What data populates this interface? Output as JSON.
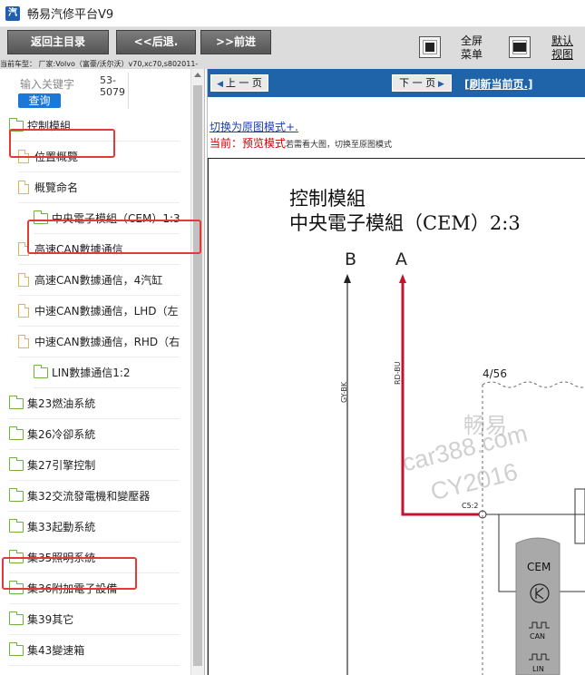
{
  "window": {
    "app_icon": "app-logo-icon",
    "title": "畅易汽修平台V9"
  },
  "toolbar": {
    "home_label": "返回主目录",
    "back_label": "<<后退.",
    "forward_label": ">>前进",
    "fullscreen_label": "全屏\n菜单",
    "fit_label": "默认\n视图",
    "fullscreen_icon": "fullscreen-icon",
    "fit_icon": "fit-view-icon"
  },
  "vehicle_info": "当前车型： 厂家:Volvo（富豪/沃尔沃）v70,xc70,s802011-",
  "search": {
    "label": "输入关键字",
    "value": "53-\n5079",
    "button_label": "查询"
  },
  "tree": {
    "items": [
      {
        "label": "控制模組",
        "type": "folder",
        "level": 0
      },
      {
        "label": "位置概覽",
        "type": "doc",
        "level": 1
      },
      {
        "label": "概覽命名",
        "type": "doc",
        "level": 1
      },
      {
        "label": "中央電子模組（CEM）1:3",
        "type": "folder",
        "level": 2
      },
      {
        "label": "高速CAN數據通信",
        "type": "doc",
        "level": 1
      },
      {
        "label": "高速CAN數據通信，4汽缸",
        "type": "doc",
        "level": 1
      },
      {
        "label": "中速CAN數據通信，LHD（左",
        "type": "doc",
        "level": 1
      },
      {
        "label": "中速CAN數據通信，RHD（右",
        "type": "doc",
        "level": 1
      },
      {
        "label": "LIN數據通信1:2",
        "type": "folder",
        "level": 2
      },
      {
        "label": "集23燃油系統",
        "type": "folder",
        "level": 0
      },
      {
        "label": "集26冷卻系統",
        "type": "folder",
        "level": 0
      },
      {
        "label": "集27引擎控制",
        "type": "folder",
        "level": 0
      },
      {
        "label": "集32交流發電機和變壓器",
        "type": "folder",
        "level": 0
      },
      {
        "label": "集33起動系統",
        "type": "folder",
        "level": 0
      },
      {
        "label": "集35照明系統",
        "type": "folder",
        "level": 0
      },
      {
        "label": "集36附加電子設備",
        "type": "folder",
        "level": 0
      },
      {
        "label": "集39其它",
        "type": "folder",
        "level": 0
      },
      {
        "label": "集43變速箱",
        "type": "folder",
        "level": 0
      }
    ]
  },
  "nav": {
    "prev_label": "上 一 页",
    "next_label": "下 一 页",
    "refresh_label": "[刷新当前页.]"
  },
  "view_mode": {
    "switch_link": "切换为原图模式+.",
    "status_prefix": "当前：",
    "status_mode": "预览模式",
    "status_hint": "若需看大图，切换至原图模式"
  },
  "diagram": {
    "title_line1": "控制模組",
    "title_line2": "中央電子模組（CEM）2:3",
    "labels": {
      "wire_b": "B",
      "wire_a": "A",
      "wire_b_color": "GY-BK",
      "wire_a_color": "RD-BU",
      "connector": "C5:2",
      "fuse_ref": "4/56",
      "module": "CEM",
      "bus1": "CAN",
      "bus2": "LIN"
    },
    "watermark": [
      "畅易",
      "car388.com",
      "CY2016"
    ]
  },
  "colors": {
    "accent": "#1f63a8",
    "highlight": "#e53935",
    "wire_red": "#c0152f"
  }
}
